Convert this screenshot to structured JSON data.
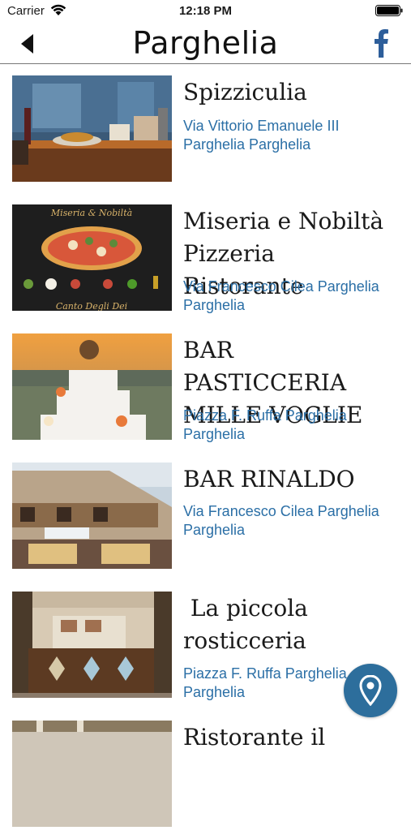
{
  "status_bar": {
    "carrier": "Carrier",
    "time": "12:18 PM"
  },
  "nav": {
    "title": "Parghelia",
    "back_icon": "back-arrow",
    "facebook_icon": "facebook"
  },
  "colors": {
    "link": "#2b6fa6",
    "fab": "#2d6e9c",
    "divider": "#777777"
  },
  "places": [
    {
      "name": "Spizziculia",
      "address": "Via Vittorio Emanuele III Parghelia Parghelia"
    },
    {
      "name": "Miseria e Nobiltà Pizzeria Ristorante",
      "address": "Via Francesco Cilea Parghelia Parghelia",
      "image_caption_top": "Miseria & Nobiltà",
      "image_caption_bottom": "Canto Degli Dei"
    },
    {
      "name": "BAR PASTICCERIA MILLE VOGLIE",
      "address": "Piazza F. Ruffa Parghelia Parghelia"
    },
    {
      "name": "BAR RINALDO",
      "address": "Via Francesco Cilea Parghelia Parghelia"
    },
    {
      "name": " La piccola rosticceria",
      "address": "Piazza F. Ruffa Parghelia Parghelia"
    },
    {
      "name": "Ristorante il",
      "address": ""
    }
  ],
  "map_button": {
    "icon": "map-pin"
  }
}
